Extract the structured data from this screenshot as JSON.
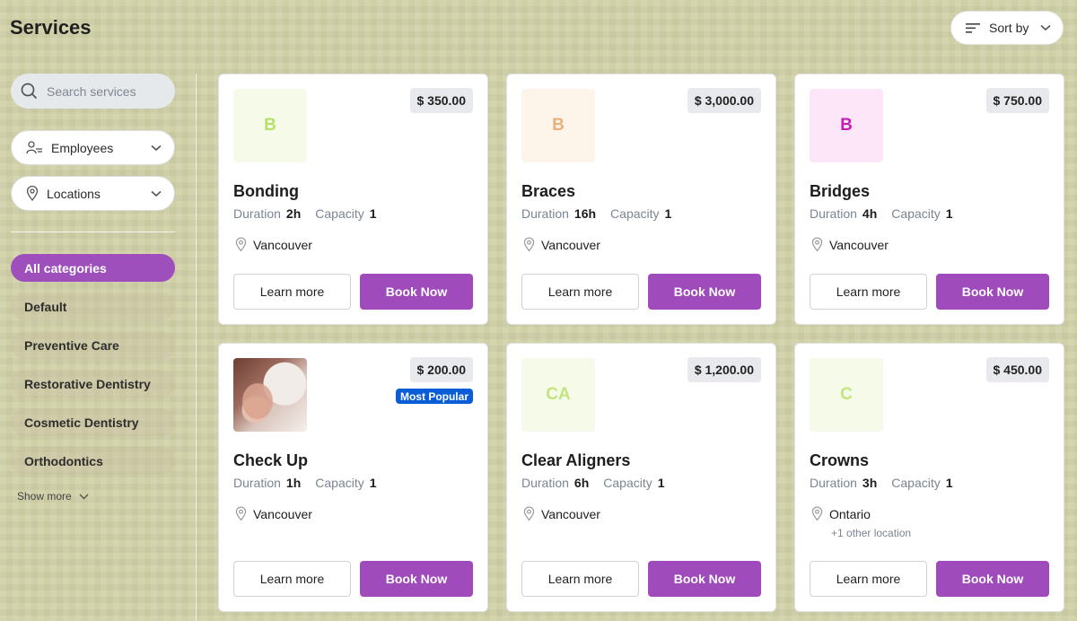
{
  "header": {
    "title": "Services",
    "sort_label": "Sort by"
  },
  "filters": {
    "search_placeholder": "Search services",
    "employees_label": "Employees",
    "locations_label": "Locations"
  },
  "categories": {
    "items": [
      {
        "label": "All categories",
        "active": true
      },
      {
        "label": "Default",
        "active": false
      },
      {
        "label": "Preventive Care",
        "active": false
      },
      {
        "label": "Restorative Dentistry",
        "active": false
      },
      {
        "label": "Cosmetic Dentistry",
        "active": false
      },
      {
        "label": "Orthodontics",
        "active": false
      }
    ],
    "show_more": "Show more"
  },
  "labels": {
    "duration": "Duration",
    "capacity": "Capacity",
    "learn_more": "Learn more",
    "book_now": "Book Now"
  },
  "services": [
    {
      "initials": "B",
      "bg": "#f6fbe9",
      "fg": "#b7e06b",
      "price": "$ 350.00",
      "name": "Bonding",
      "duration": "2h",
      "capacity": "1",
      "location": "Vancouver",
      "location_extra": "",
      "badge": "",
      "photo": false
    },
    {
      "initials": "B",
      "bg": "#fdf4ea",
      "fg": "#eab27a",
      "price": "$ 3,000.00",
      "name": "Braces",
      "duration": "16h",
      "capacity": "1",
      "location": "Vancouver",
      "location_extra": "",
      "badge": "",
      "photo": false
    },
    {
      "initials": "B",
      "bg": "#fce6f8",
      "fg": "#c41fb8",
      "price": "$ 750.00",
      "name": "Bridges",
      "duration": "4h",
      "capacity": "1",
      "location": "Vancouver",
      "location_extra": "",
      "badge": "",
      "photo": false
    },
    {
      "initials": "",
      "bg": "#ffffff",
      "fg": "#000000",
      "price": "$ 200.00",
      "name": "Check Up",
      "duration": "1h",
      "capacity": "1",
      "location": "Vancouver",
      "location_extra": "",
      "badge": "Most Popular",
      "photo": true
    },
    {
      "initials": "CA",
      "bg": "#f6fbe9",
      "fg": "#c4e57e",
      "price": "$ 1,200.00",
      "name": "Clear Aligners",
      "duration": "6h",
      "capacity": "1",
      "location": "Vancouver",
      "location_extra": "",
      "badge": "",
      "photo": false
    },
    {
      "initials": "C",
      "bg": "#f6fbe9",
      "fg": "#c4e57e",
      "price": "$ 450.00",
      "name": "Crowns",
      "duration": "3h",
      "capacity": "1",
      "location": "Ontario",
      "location_extra": "+1 other location",
      "badge": "",
      "photo": false
    }
  ],
  "colors": {
    "accent": "#a04bbb",
    "badge": "#0a5dd6"
  }
}
